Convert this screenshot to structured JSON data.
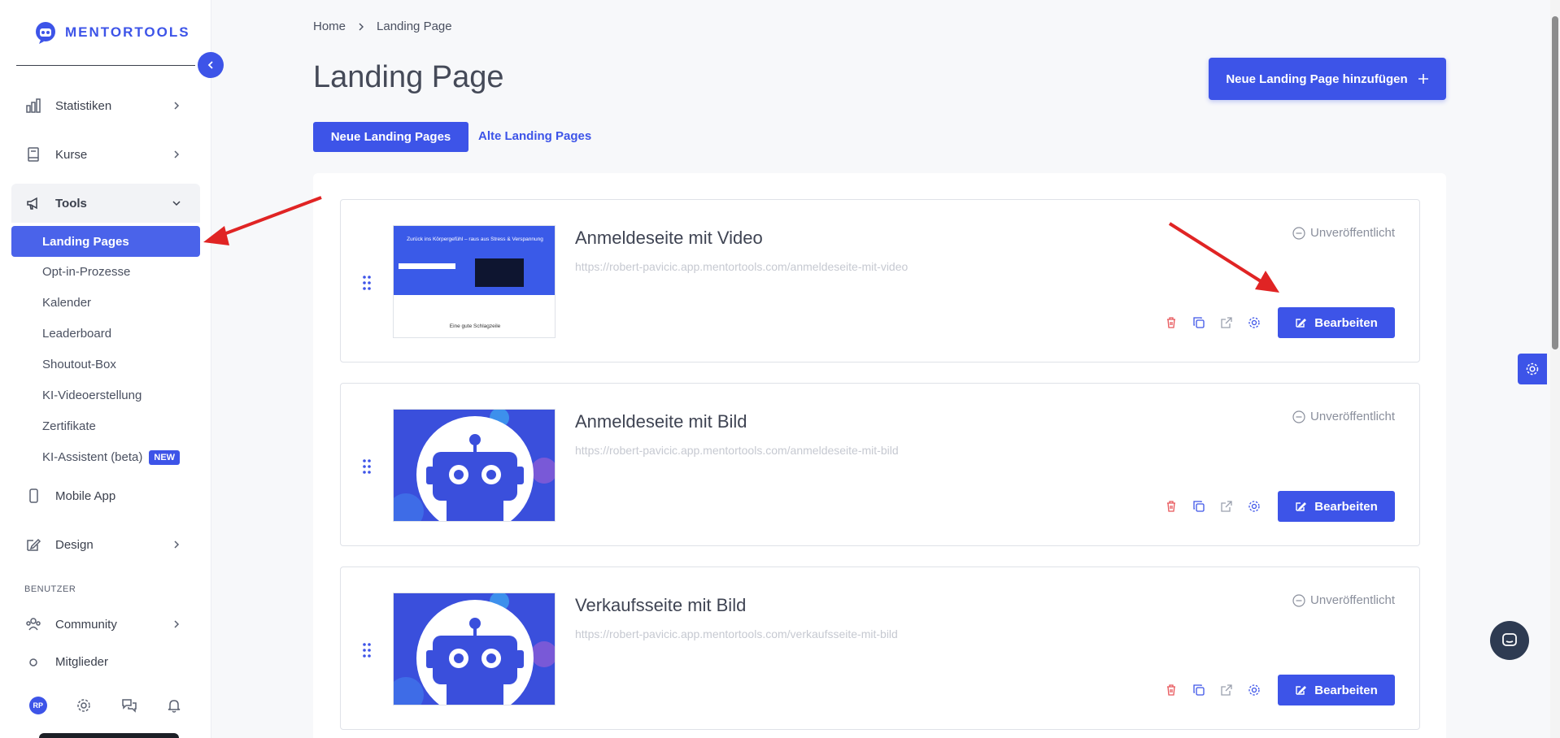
{
  "brand": {
    "name": "MENTORTOOLS",
    "color": "#3d54e8"
  },
  "sidebar": {
    "items": [
      {
        "label": "Statistiken",
        "icon": "bar-chart-icon"
      },
      {
        "label": "Kurse",
        "icon": "book-icon"
      },
      {
        "label": "Tools",
        "icon": "megaphone-icon"
      }
    ],
    "tools_sub": [
      {
        "label": "Landing Pages"
      },
      {
        "label": "Opt-in-Prozesse"
      },
      {
        "label": "Kalender"
      },
      {
        "label": "Leaderboard"
      },
      {
        "label": "Shoutout-Box"
      },
      {
        "label": "KI-Videoerstellung"
      },
      {
        "label": "Zertifikate"
      },
      {
        "label": "KI-Assistent (beta)",
        "badge": "NEW"
      }
    ],
    "mobile_app": "Mobile App",
    "design": "Design",
    "section_user": "BENUTZER",
    "community": "Community",
    "members": "Mitglieder",
    "avatar_initials": "RP"
  },
  "breadcrumb": {
    "home": "Home",
    "current": "Landing Page"
  },
  "page_title": "Landing Page",
  "add_button": "Neue Landing Page hinzufügen",
  "tabs": {
    "active": "Neue Landing Pages",
    "other": "Alte Landing Pages"
  },
  "cards": [
    {
      "title": "Anmeldeseite mit Video",
      "url": "https://robert-pavicic.app.mentortools.com/anmeldeseite-mit-video",
      "status": "Unveröffentlicht",
      "edit": "Bearbeiten",
      "thumb": {
        "type": "video",
        "headline": "Zurück ins Körpergefühl – raus aus Stress & Verspannung",
        "subline": "Eine gute Schlagzeile"
      }
    },
    {
      "title": "Anmeldeseite mit Bild",
      "url": "https://robert-pavicic.app.mentortools.com/anmeldeseite-mit-bild",
      "status": "Unveröffentlicht",
      "edit": "Bearbeiten",
      "thumb": {
        "type": "robot"
      }
    },
    {
      "title": "Verkaufsseite mit Bild",
      "url": "https://robert-pavicic.app.mentortools.com/verkaufsseite-mit-bild",
      "status": "Unveröffentlicht",
      "edit": "Bearbeiten",
      "thumb": {
        "type": "robot"
      }
    }
  ]
}
